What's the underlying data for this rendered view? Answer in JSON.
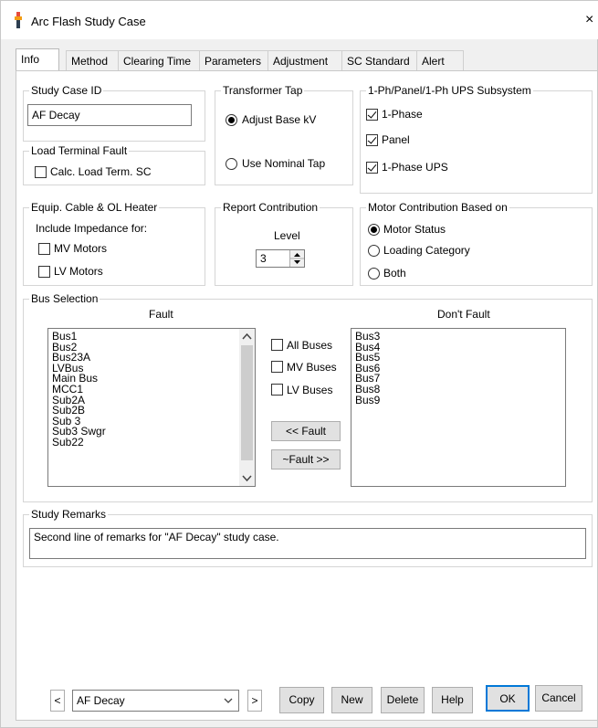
{
  "window": {
    "title": "Arc Flash Study Case",
    "close_glyph": "×"
  },
  "tabs": [
    "Info",
    "Method",
    "Clearing Time",
    "Parameters",
    "Adjustment",
    "SC Standard",
    "Alert"
  ],
  "study_case_id": {
    "label": "Study Case ID",
    "value": "AF Decay"
  },
  "transformer_tap": {
    "label": "Transformer Tap",
    "option_adjust": "Adjust Base kV",
    "option_nominal": "Use Nominal Tap",
    "selected": "Adjust Base kV"
  },
  "subsystem": {
    "label": "1-Ph/Panel/1-Ph UPS Subsystem",
    "one_phase": "1-Phase",
    "panel": "Panel",
    "one_phase_ups": "1-Phase UPS"
  },
  "load_terminal": {
    "label": "Load Terminal Fault",
    "calc_label": "Calc. Load Term. SC",
    "checked": false
  },
  "equip_cable": {
    "label": "Equip. Cable & OL Heater",
    "include_label": "Include Impedance for:",
    "mv_motors": "MV Motors",
    "lv_motors": "LV Motors"
  },
  "report_contribution": {
    "label": "Report Contribution",
    "level_label": "Level",
    "level_value": "3"
  },
  "motor_contribution": {
    "label": "Motor Contribution Based on",
    "motor_status": "Motor Status",
    "loading_category": "Loading Category",
    "both": "Both",
    "selected": "Motor Status"
  },
  "bus_selection": {
    "label": "Bus Selection",
    "fault_header": "Fault",
    "dont_fault_header": "Don't Fault",
    "fault_items": [
      "Bus1",
      "Bus2",
      "Bus23A",
      "LVBus",
      "Main Bus",
      "MCC1",
      "Sub2A",
      "Sub2B",
      "Sub 3",
      "Sub3 Swgr",
      "Sub22"
    ],
    "dont_fault_items": [
      "Bus3",
      "Bus4",
      "Bus5",
      "Bus6",
      "Bus7",
      "Bus8",
      "Bus9"
    ],
    "all_buses": "All Buses",
    "mv_buses": "MV Buses",
    "lv_buses": "LV Buses",
    "fault_btn": "<< Fault",
    "not_fault_btn": "~Fault >>"
  },
  "study_remarks": {
    "label": "Study Remarks",
    "text": "Second line of remarks for \"AF Decay\" study case."
  },
  "bottom": {
    "prev_glyph": "<",
    "next_glyph": ">",
    "case_select": "AF Decay",
    "copy": "Copy",
    "new": "New",
    "delete": "Delete",
    "help": "Help",
    "ok": "OK",
    "cancel": "Cancel"
  },
  "colors": {
    "accent_icon": "#c0392b",
    "window_bg": "#f0f0f0",
    "panel_bg": "#ffffff"
  }
}
